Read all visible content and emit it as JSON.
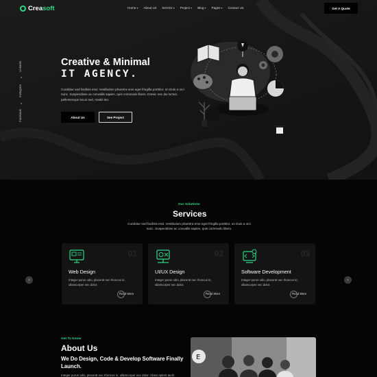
{
  "nav": {
    "logo_main": "Crea",
    "logo_accent": "soft",
    "menu": [
      {
        "label": "Home",
        "dropdown": true
      },
      {
        "label": "About Us",
        "dropdown": false
      },
      {
        "label": "Service",
        "dropdown": true
      },
      {
        "label": "Project",
        "dropdown": true
      },
      {
        "label": "Blog",
        "dropdown": true
      },
      {
        "label": "Pages",
        "dropdown": true
      },
      {
        "label": "Contact Us",
        "dropdown": false
      }
    ],
    "cta": "Get A Quote"
  },
  "social": [
    "Facebook",
    "Instagram",
    "LinkedIn"
  ],
  "hero": {
    "title": "Creative & Minimal",
    "subtitle": "IT AGENCY.",
    "description": "Curabitur sed facilisis erat. Vestibulum pharetra eros eget fringilla porttitor. on Duis a orci nunc. Suspendisse ac convallis sapien, quis commodo libero. Donec nec dui luctus, pellentesque lacus sed, mattis leo.",
    "primary_button": "About Us",
    "secondary_button": "See Project"
  },
  "services": {
    "eyebrow": "Our Solutions",
    "title": "Services",
    "description": "Curabitur sed facilisis erat. Vestibulum pharetra eros eget fringilla porttitor. on Duis a orci nunc. Suspendisse ac convallis sapien, quis commodo libero.",
    "cards": [
      {
        "title": "Web Design",
        "number": "01",
        "icon": "web-design-icon",
        "description": "Integer purus odio, placerat nec rhoncus in, ullamcorper nec dolor.",
        "link": "Read More"
      },
      {
        "title": "UI/UX Design",
        "number": "02",
        "icon": "ui-ux-icon",
        "description": "Integer purus odio, placerat nec rhoncus in, ullamcorper nec dolor.",
        "link": "Read More"
      },
      {
        "title": "Software Development",
        "number": "03",
        "icon": "software-dev-icon",
        "description": "Integer purus odio, placerat nec rhoncus in, ullamcorper nec dolor.",
        "link": "Read More"
      }
    ],
    "prev": "‹",
    "next": "›"
  },
  "about": {
    "eyebrow": "Get To Know",
    "title": "About Us",
    "subtitle": "We Do Design, Code & Develop Software Finally Launch.",
    "description": "Integer purus odio, placerat nec rhoncus in, ullamcorper nec dolor. Class aptent taciti"
  },
  "colors": {
    "accent": "#2fd98b",
    "hero_bg": "#1a1a1a",
    "section_bg": "#050505",
    "card_bg": "#141414"
  }
}
